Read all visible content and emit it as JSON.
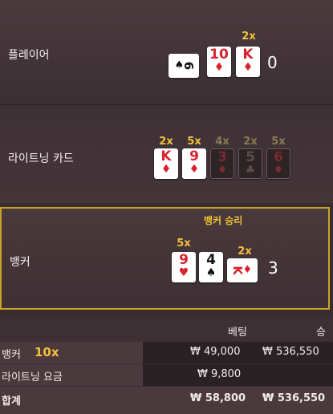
{
  "rows": {
    "player": {
      "label": "플레이어",
      "score": "0",
      "multiplier": "2x",
      "cards": [
        {
          "rank": "6",
          "suit": "♠",
          "color": "black",
          "orientation": "sideways"
        },
        {
          "rank": "10",
          "suit": "♦",
          "color": "red"
        },
        {
          "rank": "K",
          "suit": "♦",
          "color": "red"
        }
      ]
    },
    "lightning": {
      "label": "라이트닝 카드",
      "cards": [
        {
          "rank": "K",
          "suit": "♦",
          "color": "red",
          "multiplier": "2x",
          "active": true
        },
        {
          "rank": "9",
          "suit": "♦",
          "color": "red",
          "multiplier": "5x",
          "active": true
        },
        {
          "rank": "3",
          "suit": "♦",
          "color": "red",
          "multiplier": "4x",
          "active": false
        },
        {
          "rank": "5",
          "suit": "♣",
          "color": "black",
          "multiplier": "2x",
          "active": false
        },
        {
          "rank": "6",
          "suit": "♦",
          "color": "red",
          "multiplier": "5x",
          "active": false
        }
      ]
    },
    "banker": {
      "label": "뱅커",
      "win_label": "뱅커 승리",
      "score": "3",
      "cards": [
        {
          "rank": "9",
          "suit": "♥",
          "color": "red",
          "multiplier": "5x"
        },
        {
          "rank": "4",
          "suit": "♠",
          "color": "black"
        },
        {
          "rank": "K",
          "suit": "♦",
          "color": "red",
          "multiplier": "2x",
          "orientation": "sideways"
        }
      ]
    }
  },
  "bets": {
    "headers": {
      "bet": "베팅",
      "win": "승"
    },
    "rows": [
      {
        "label": "뱅커",
        "tag": "10x",
        "bet": "₩ 49,000",
        "win": "₩ 536,550"
      },
      {
        "label": "라이트닝 요금",
        "bet": "₩ 9,800",
        "win": ""
      }
    ],
    "total": {
      "label": "합계",
      "bet": "₩ 58,800",
      "win": "₩ 536,550"
    }
  },
  "colors": {
    "gold": "#f3c03d",
    "red_suit": "#d8232e",
    "border_win": "#c9a227"
  }
}
